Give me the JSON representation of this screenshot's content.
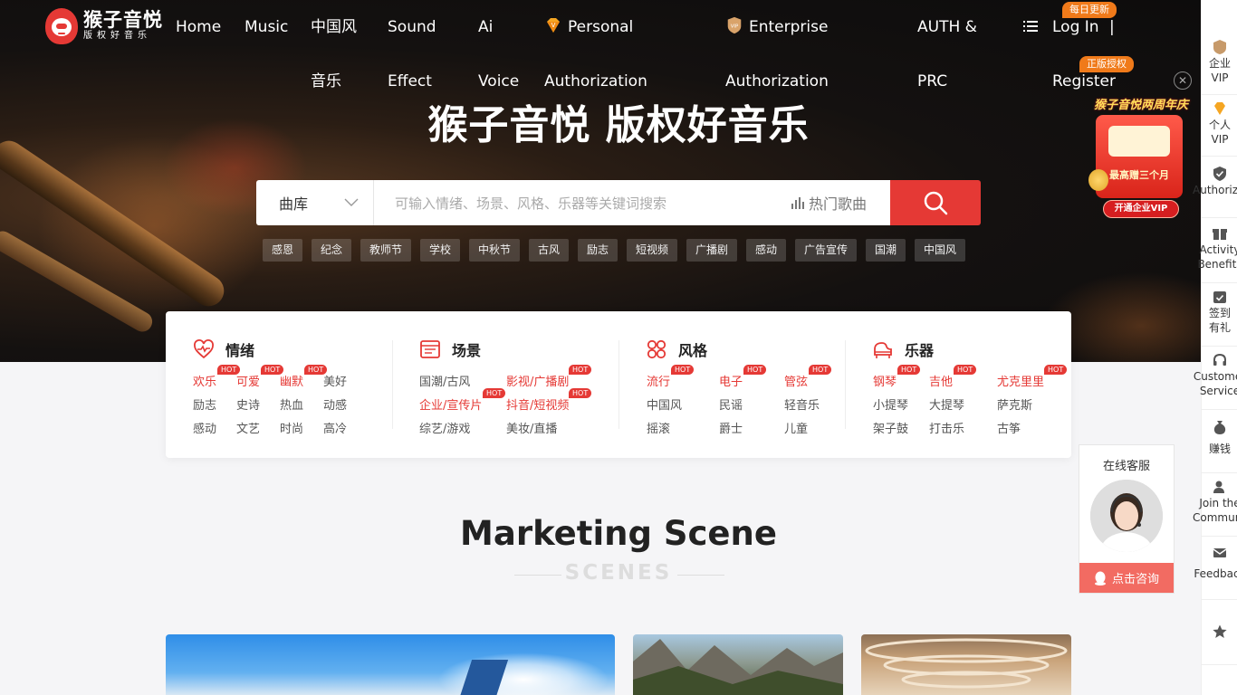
{
  "brand": {
    "name": "猴子音悦",
    "tagline": "版权好音乐"
  },
  "nav": {
    "home": "Home",
    "music": "Music",
    "chinese_line1": "中国风",
    "chinese_line2": "音乐",
    "sound_line1": "Sound",
    "sound_line2": "Effect",
    "ai_line1": "Ai",
    "ai_line2": "Voice",
    "personal_line1": "Personal",
    "personal_line2": "Authorization",
    "enterprise_line1": "Enterprise",
    "enterprise_line2": "Authorization",
    "auth_line1": "AUTH &",
    "auth_line2": "PRC",
    "login": "Log In",
    "separator": "|",
    "register": "Register",
    "badge_daily": "每日更新",
    "badge_licensed": "正版授权",
    "enterprise_badge": "VIP"
  },
  "hero": {
    "title": "猴子音悦 版权好音乐"
  },
  "search": {
    "category": "曲库",
    "placeholder": "可输入情绪、场景、风格、乐器等关键词搜索",
    "hot_label": "热门歌曲"
  },
  "tags": [
    "感恩",
    "纪念",
    "教师节",
    "学校",
    "中秋节",
    "古风",
    "励志",
    "短视频",
    "广播剧",
    "感动",
    "广告宣传",
    "国潮",
    "中国风"
  ],
  "hot_label": "HOT",
  "categories": {
    "mood": {
      "title": "情绪",
      "items": [
        "欢乐",
        "可爱",
        "幽默",
        "美好",
        "励志",
        "史诗",
        "热血",
        "动感",
        "感动",
        "文艺",
        "时尚",
        "高冷"
      ]
    },
    "scene": {
      "title": "场景",
      "items": [
        "国潮/古风",
        "影视/广播剧",
        "企业/宣传片",
        "抖音/短视频",
        "综艺/游戏",
        "美妆/直播"
      ]
    },
    "style": {
      "title": "风格",
      "items": [
        "流行",
        "电子",
        "管弦",
        "中国风",
        "民谣",
        "轻音乐",
        "摇滚",
        "爵士",
        "儿童"
      ]
    },
    "instrument": {
      "title": "乐器",
      "items": [
        "钢琴",
        "吉他",
        "尤克里里",
        "小提琴",
        "大提琴",
        "萨克斯",
        "架子鼓",
        "打击乐",
        "古筝"
      ]
    }
  },
  "section": {
    "title": "Marketing Scene",
    "subtitle": "SCENES"
  },
  "sidebar": {
    "enterprise_vip_line1": "企业",
    "enterprise_vip_line2": "VIP",
    "personal_vip_line1": "个人",
    "personal_vip_line2": "VIP",
    "authorization": "Authorization",
    "activity_line1": "Activity",
    "activity_line2": "Benefits",
    "signin_line1": "签到",
    "signin_line2": "有礼",
    "service_line1": "Customer",
    "service_line2": "Service",
    "earn": "赚钱",
    "join_line1": "Join the",
    "join_line2": "Community",
    "feedback": "Feedback"
  },
  "promo": {
    "title": "猴子音悦两周年庆",
    "headline": "最高赠三个月",
    "button": "开通企业VIP"
  },
  "kefu": {
    "title": "在线客服",
    "button": "点击咨询"
  },
  "colors": {
    "accent": "#e53935",
    "badge": "#f07a1a",
    "gold": "#f5a623"
  }
}
